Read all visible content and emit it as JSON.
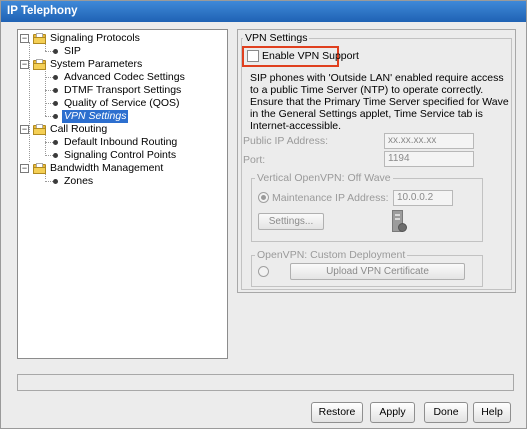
{
  "window": {
    "title": "IP Telephony"
  },
  "tree": {
    "items": [
      {
        "label": "Signaling Protocols",
        "kind": "folder",
        "expanded": true
      },
      {
        "label": "SIP",
        "kind": "leaf"
      },
      {
        "label": "System Parameters",
        "kind": "folder",
        "expanded": true
      },
      {
        "label": "Advanced Codec Settings",
        "kind": "leaf"
      },
      {
        "label": "DTMF Transport Settings",
        "kind": "leaf"
      },
      {
        "label": "Quality of Service (QOS)",
        "kind": "leaf"
      },
      {
        "label": "VPN Settings",
        "kind": "leaf",
        "selected": true
      },
      {
        "label": "Call Routing",
        "kind": "folder",
        "expanded": true
      },
      {
        "label": "Default Inbound Routing",
        "kind": "leaf"
      },
      {
        "label": "Signaling Control Points",
        "kind": "leaf"
      },
      {
        "label": "Bandwidth Management",
        "kind": "folder",
        "expanded": true
      },
      {
        "label": "Zones",
        "kind": "leaf"
      }
    ]
  },
  "vpn": {
    "group_title": "VPN Settings",
    "enable_label": "Enable VPN Support",
    "enable_checked": false,
    "description": "SIP phones with 'Outside LAN' enabled require access to a public Time Server (NTP) to operate correctly. Ensure that the Primary Time Server specified for Wave in the General Settings applet, Time Service tab is Internet-accessible.",
    "public_ip_label": "Public IP Address:",
    "public_ip_value": "xx.xx.xx.xx",
    "port_label": "Port:",
    "port_value": "1194",
    "vertical_group_title": "Vertical OpenVPN: Off Wave",
    "maintenance_ip_label": "Maintenance IP Address:",
    "maintenance_ip_value": "10.0.0.2",
    "settings_button": "Settings...",
    "custom_group_title": "OpenVPN: Custom Deployment",
    "upload_button": "Upload VPN Certificate"
  },
  "footer": {
    "restore": "Restore",
    "apply": "Apply",
    "done": "Done",
    "help": "Help"
  },
  "colors": {
    "titlebar": "#1f62b4",
    "selection": "#2d6fcf",
    "highlight_box": "#e0401f"
  }
}
